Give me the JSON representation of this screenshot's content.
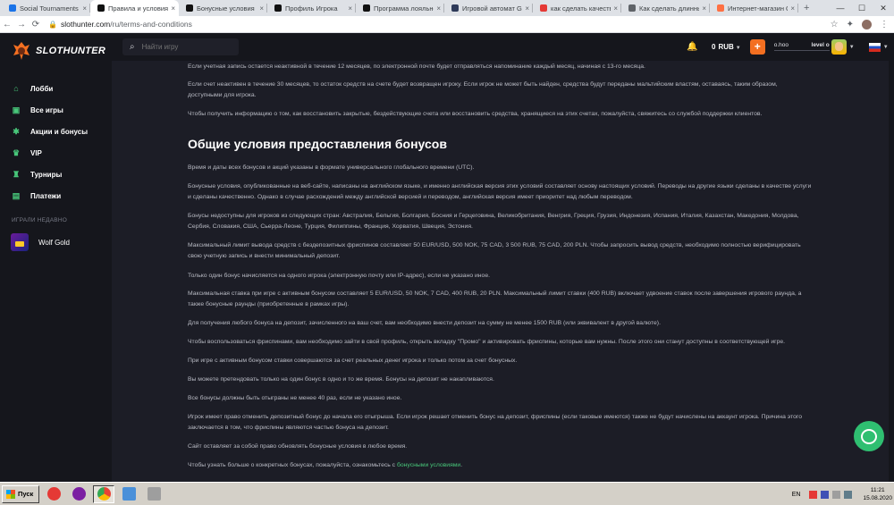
{
  "browser": {
    "tabs": [
      {
        "title": "Social Tournaments",
        "favicon_color": "#1a73e8",
        "active": false
      },
      {
        "title": "Правила и условия | Sl",
        "favicon_color": "#111111",
        "active": true
      },
      {
        "title": "Бонусные условия | Sl",
        "favicon_color": "#111111",
        "active": false
      },
      {
        "title": "Профиль Игрока",
        "favicon_color": "#111111",
        "active": false
      },
      {
        "title": "Программа лояльност",
        "favicon_color": "#111111",
        "active": false
      },
      {
        "title": "Игровой автомат Gold",
        "favicon_color": "#2e3a59",
        "active": false
      },
      {
        "title": "как сделать качествен",
        "favicon_color": "#e53935",
        "active": false
      },
      {
        "title": "Как сделать длинный с",
        "favicon_color": "#5f6368",
        "active": false
      },
      {
        "title": "Интернет-магазин Chi",
        "favicon_color": "#ff7043",
        "active": false
      }
    ],
    "url_host": "slothunter.com",
    "url_path": "/ru/terms-and-conditions"
  },
  "header": {
    "logo_text": "SLOTHUNTER",
    "search_placeholder": "Найти игру",
    "balance_amount": "0",
    "balance_currency": "RUB",
    "plus_label": "+",
    "username": "o.hoo",
    "level": "level o"
  },
  "sidebar": {
    "items": [
      {
        "label": "Лобби",
        "icon": "home-icon"
      },
      {
        "label": "Все игры",
        "icon": "gamepad-icon"
      },
      {
        "label": "Акции и бонусы",
        "icon": "gift-icon"
      },
      {
        "label": "VIP",
        "icon": "crown-icon"
      },
      {
        "label": "Турниры",
        "icon": "trophy-icon"
      },
      {
        "label": "Платежи",
        "icon": "wallet-icon"
      }
    ],
    "recent_title": "ИГРАЛИ НЕДАВНО",
    "recent_games": [
      {
        "label": "Wolf Gold"
      }
    ]
  },
  "content": {
    "p1": "Если учетная запись остается неактивной в течение 12 месяцев, по электронной почте будет отправляться напоминание каждый месяц, начиная с 13-го месяца.",
    "p2": "Если счет неактивен в течение 30 месяцев, то остаток средств на счете будет возвращен игроку. Если игрок не может быть найден, средства будут переданы мальтийским властям, оставаясь, таким образом, доступными для игрока.",
    "p3": "Чтобы получить информацию о том, как восстановить закрытые, бездействующие счета или восстановить средства, хранящиеся на этих счетах, пожалуйста, свяжитесь со службой поддержки клиентов.",
    "heading": "Общие условия предоставления бонусов",
    "p4": "Время и даты всех бонусов и акций указаны в формате универсального глобального времени (UTC).",
    "p5": "Бонусные условия, опубликованные на веб-сайте, написаны на английском языке, и именно английская версия этих условий составляет основу настоящих условий. Переводы на другие языки сделаны в качестве услуги и сделаны качественно. Однако в случае расхождений между английской версией и переводом, английская версия имеет приоритет над любым переводом.",
    "p6": "Бонусы недоступны для игроков из следующих стран: Австралия, Бельгия, Болгария, Босния и Герцеговина, Великобритания, Венгрия, Греция, Грузия, Индонезия, Испания, Италия, Казахстан, Македония, Молдова, Сербия, Словакия, США, Сьерра-Леоне, Турция, Филиппины, Франция, Хорватия, Швеция, Эстония.",
    "p7": "Максимальный лимит вывода средств с бездепозитных фриспинов составляет 50 EUR/USD, 500 NOK, 75 CAD, 3 500 RUB, 75 CAD, 200 PLN. Чтобы запросить вывод средств, необходимо полностью верифицировать свою учетную запись и внести минимальный депозит.",
    "p8": "Только один бонус начисляется на одного игрока (электронную почту или IP-адрес), если не указано иное.",
    "p9": "Максимальная ставка при игре с активным бонусом составляет 5 EUR/USD, 50 NOK, 7 CAD, 400 RUB, 20 PLN. Максимальный лимит ставки (400 RUB) включает удвоение ставок после завершения игрового раунда, а также бонусные раунды (приобретенные в рамках игры).",
    "p10": "Для получения любого бонуса на депозит, зачисленного на ваш счет, вам необходимо внести депозит на сумму не менее 1500 RUB (или эквивалент в другой валюте).",
    "p11": "Чтобы воспользоваться фриспинами, вам необходимо зайти в свой профиль, открыть вкладку \"Промо\" и активировать фриспины, которые вам нужны. После этого они станут доступны в соответствующей игре.",
    "p12": "При игре с активным бонусом ставки совершаются за счет реальных денег игрока и только потом за счет бонусных.",
    "p13": "Вы можете претендовать только на один бонус в одно и то же время. Бонусы на депозит не накапливаются.",
    "p14": "Все бонусы должны быть отыграны не менее 40 раз, если не указано иное.",
    "p15": "Игрок имеет право отменить депозитный бонус до начала его отыгрыша. Если игрок решает отменить бонус на депозит, фриспины (если таковые имеются) также не будут начислены на аккаунт игрока. Причина этого заключается в том, что фриспины являются частью бонуса на депозит.",
    "p16": "Сайт оставляет за собой право обновлять бонусные условия в любое время.",
    "p17_text": "Чтобы узнать больше о конкретных бонусах, пожалуйста, ознакомьтесь с ",
    "p17_link": "бонусными условиями",
    "p17_end": "."
  },
  "taskbar": {
    "start_label": "Пуск",
    "lang": "EN",
    "time": "11:21",
    "date": "15.08.2020"
  }
}
